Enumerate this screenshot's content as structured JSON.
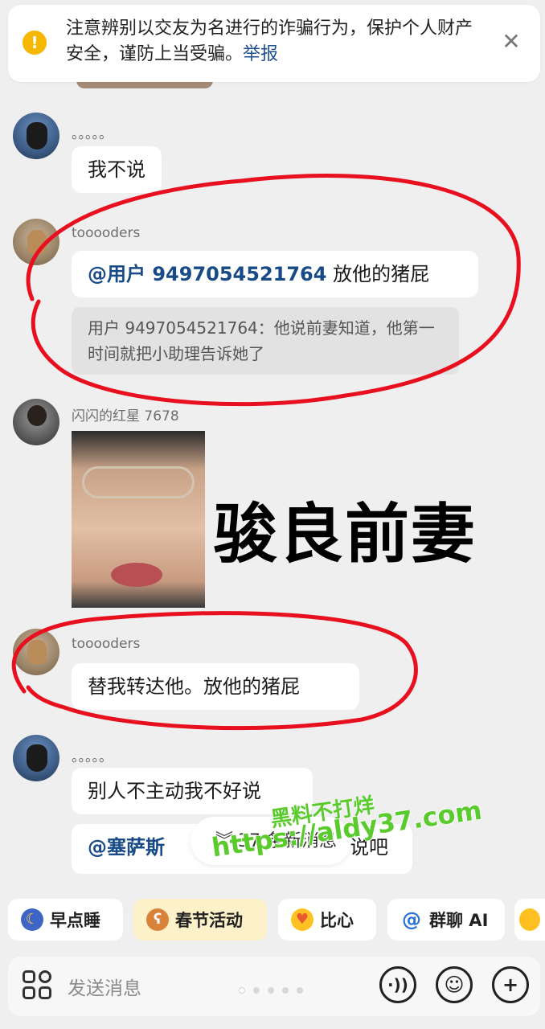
{
  "banner": {
    "icon_name": "warning-icon",
    "text": "注意辨别以交友为名进行的诈骗行为，保护个人财产安全，谨防上当受骗。",
    "link": "举报",
    "close_icon": "close-icon"
  },
  "messages": [
    {
      "sender": "。。。。。",
      "text": "我不说"
    },
    {
      "sender": "tooooders",
      "mention": "@用户 9497054521764",
      "text": " 放他的猪屁",
      "quote": "用户 9497054521764：他说前妻知道，他第一时间就把小助理告诉她了"
    },
    {
      "sender": "闪闪的红星 7678",
      "sticker_caption": "骏良前妻"
    },
    {
      "sender": "tooooders",
      "text": "替我转达他。放他的猪屁"
    },
    {
      "sender": "。。。。。",
      "text": "别人不主动我不好说",
      "mention": "@塞萨斯",
      "text_tail": "说吧"
    }
  ],
  "new_messages": "37 条新消息",
  "watermark": {
    "line1": "黑料不打烊",
    "line2": "https://aldy37.com"
  },
  "chips": [
    {
      "label": "早点睡",
      "icon": "moon-icon"
    },
    {
      "label": "春节活动",
      "icon": "bear-icon"
    },
    {
      "label": "比心",
      "icon": "heart-chick-icon"
    },
    {
      "label": "群聊 AI",
      "icon": "at-icon"
    }
  ],
  "input": {
    "placeholder": "发送消息"
  },
  "colors": {
    "mention": "#174a86",
    "annotation": "#e8101e",
    "watermark": "#5acb2c"
  }
}
